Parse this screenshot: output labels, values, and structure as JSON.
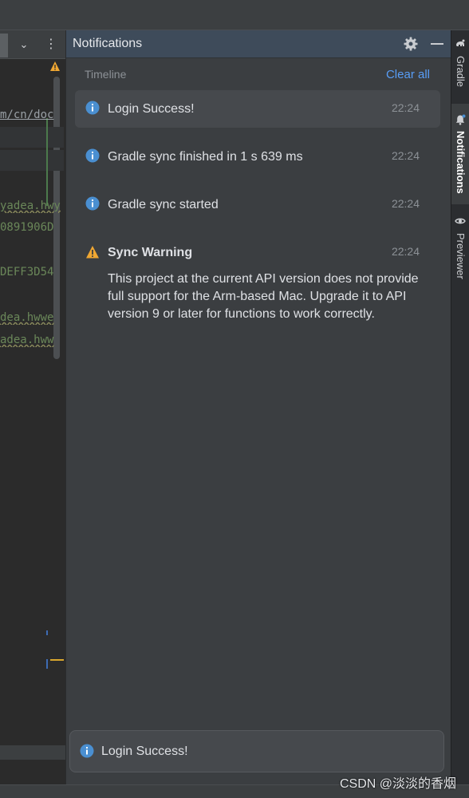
{
  "editor": {
    "code_lines": [
      {
        "text": "m/cn/doc",
        "kind": "url"
      },
      {
        "text": "yadea.hwy",
        "kind": "str"
      },
      {
        "text": "0891906D",
        "kind": "hex"
      },
      {
        "text": "DEFF3D54",
        "kind": "hex"
      },
      {
        "text": "dea.hwwe",
        "kind": "str"
      },
      {
        "text": "adea.hww",
        "kind": "str"
      }
    ],
    "chevron_glyph": "⌄",
    "kebab_glyph": "⋮"
  },
  "panel": {
    "title": "Notifications",
    "timeline_label": "Timeline",
    "clear_all_label": "Clear all"
  },
  "notifications": [
    {
      "type": "info",
      "title": "Login Success!",
      "time": "22:24",
      "body": "",
      "selected": true
    },
    {
      "type": "info",
      "title": "Gradle sync finished in 1 s 639 ms",
      "time": "22:24",
      "body": "",
      "selected": false
    },
    {
      "type": "info",
      "title": "Gradle sync started",
      "time": "22:24",
      "body": "",
      "selected": false
    },
    {
      "type": "warning",
      "title": "Sync Warning",
      "time": "22:24",
      "body": "This project at the current API version does not provide full support for the Arm-based Mac. Upgrade it to API version 9 or later for functions to work correctly.",
      "selected": false
    }
  ],
  "balloon": {
    "type": "info",
    "text": "Login Success!"
  },
  "tool_strip": [
    {
      "label": "Gradle",
      "icon": "gradle-elephant-icon",
      "active": false
    },
    {
      "label": "Notifications",
      "icon": "bell-icon",
      "active": true
    },
    {
      "label": "Previewer",
      "icon": "eye-icon",
      "active": false
    }
  ],
  "watermark": "CSDN @淡淡的香烟",
  "colors": {
    "info": "#4a8fd1",
    "warning": "#f0a732",
    "link": "#589df6",
    "panel_header": "#3e4b5a"
  }
}
